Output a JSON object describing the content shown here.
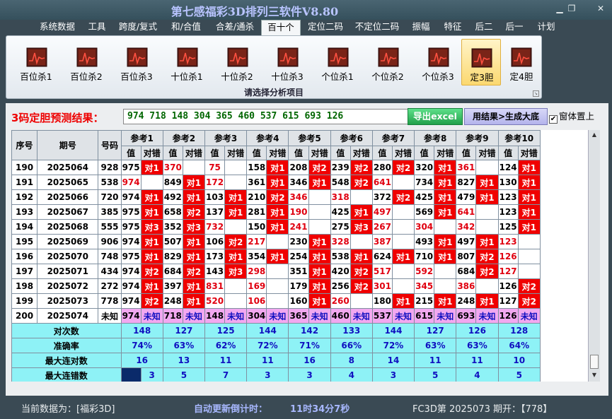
{
  "window": {
    "title": "第七感福彩3D排列三软件V8.80"
  },
  "menu": [
    "系统数据",
    "工具",
    "跨度/复式",
    "和/合值",
    "合差/通杀",
    "百十个",
    "定位二码",
    "不定位二码",
    "振幅",
    "特征",
    "后二",
    "后一",
    "计划"
  ],
  "menu_active": 5,
  "ribbon": {
    "items": [
      "百位杀1",
      "百位杀2",
      "百位杀3",
      "十位杀1",
      "十位杀2",
      "十位杀3",
      "个位杀1",
      "个位杀2",
      "个位杀3",
      "定3胆",
      "定4胆"
    ],
    "selected": 9,
    "caption": "请选择分析项目"
  },
  "result": {
    "label": "3码定胆预测结果：",
    "value": "974 718 148 304 365 460 537 615 693 126",
    "export_label": "导出excel",
    "gen_label": "用结果>生成大底",
    "top_label": "窗体置上",
    "top_checked": true
  },
  "table": {
    "h_seq": "序号",
    "h_period": "期号",
    "h_num": "号码",
    "ref_labels": [
      "参考1",
      "参考2",
      "参考3",
      "参考4",
      "参考5",
      "参考6",
      "参考7",
      "参考8",
      "参考9",
      "参考10"
    ],
    "sub_val": "值",
    "sub_res": "对错",
    "rows": [
      {
        "seq": "190",
        "period": "2025064",
        "num": "928",
        "v": [
          "975",
          "370",
          "75",
          "158",
          "208",
          "239",
          "280",
          "320",
          "361",
          "124"
        ],
        "r": [
          "对1",
          "",
          "",
          "对1",
          "对2",
          "对2",
          "对2",
          "对1",
          "",
          "对1"
        ]
      },
      {
        "seq": "191",
        "period": "2025065",
        "num": "538",
        "v": [
          "974",
          "849",
          "172",
          "361",
          "346",
          "548",
          "641",
          "734",
          "827",
          "130"
        ],
        "r": [
          "",
          "对1",
          "",
          "对1",
          "对1",
          "对2",
          "",
          "对1",
          "对1",
          "对1"
        ]
      },
      {
        "seq": "192",
        "period": "2025066",
        "num": "720",
        "v": [
          "974",
          "492",
          "103",
          "210",
          "346",
          "318",
          "372",
          "425",
          "479",
          "123"
        ],
        "r": [
          "对1",
          "对1",
          "对1",
          "对2",
          "",
          "",
          "对2",
          "对1",
          "对1",
          "对1"
        ]
      },
      {
        "seq": "193",
        "period": "2025067",
        "num": "385",
        "v": [
          "975",
          "658",
          "137",
          "281",
          "190",
          "425",
          "497",
          "569",
          "641",
          "123"
        ],
        "r": [
          "对1",
          "对2",
          "对1",
          "对1",
          "",
          "对1",
          "",
          "对1",
          "",
          "对1"
        ]
      },
      {
        "seq": "194",
        "period": "2025068",
        "num": "555",
        "v": [
          "975",
          "352",
          "732",
          "150",
          "241",
          "275",
          "267",
          "304",
          "342",
          "125"
        ],
        "r": [
          "对3",
          "对3",
          "",
          "对1",
          "",
          "对3",
          "",
          "",
          "",
          "对1"
        ]
      },
      {
        "seq": "195",
        "period": "2025069",
        "num": "906",
        "v": [
          "974",
          "507",
          "106",
          "217",
          "230",
          "328",
          "387",
          "493",
          "497",
          "123"
        ],
        "r": [
          "对1",
          "对1",
          "对2",
          "",
          "对1",
          "",
          "",
          "对1",
          "对1",
          ""
        ]
      },
      {
        "seq": "196",
        "period": "2025070",
        "num": "748",
        "v": [
          "975",
          "829",
          "173",
          "354",
          "254",
          "538",
          "624",
          "710",
          "807",
          "126"
        ],
        "r": [
          "对1",
          "对1",
          "对1",
          "对1",
          "对1",
          "对1",
          "对1",
          "对1",
          "对2",
          ""
        ]
      },
      {
        "seq": "197",
        "period": "2025071",
        "num": "434",
        "v": [
          "974",
          "684",
          "143",
          "298",
          "351",
          "420",
          "517",
          "592",
          "684",
          "127"
        ],
        "r": [
          "对2",
          "对2",
          "对3",
          "",
          "对1",
          "对2",
          "",
          "",
          "对2",
          ""
        ]
      },
      {
        "seq": "198",
        "period": "2025072",
        "num": "272",
        "v": [
          "974",
          "397",
          "831",
          "169",
          "179",
          "256",
          "301",
          "345",
          "386",
          "126"
        ],
        "r": [
          "对1",
          "对1",
          "",
          "",
          "对1",
          "对2",
          "",
          "",
          "",
          "对2"
        ]
      },
      {
        "seq": "199",
        "period": "2025073",
        "num": "778",
        "v": [
          "974",
          "248",
          "520",
          "106",
          "160",
          "260",
          "180",
          "215",
          "248",
          "127"
        ],
        "r": [
          "对2",
          "对1",
          "",
          "",
          "对1",
          "",
          "对1",
          "对1",
          "对1",
          "对2"
        ]
      },
      {
        "seq": "200",
        "period": "2025074",
        "num": "未知",
        "v": [
          "974",
          "718",
          "148",
          "304",
          "365",
          "460",
          "537",
          "615",
          "693",
          "126"
        ],
        "r": [
          "未知",
          "未知",
          "未知",
          "未知",
          "未知",
          "未知",
          "未知",
          "未知",
          "未知",
          "未知"
        ]
      }
    ],
    "summary": [
      {
        "label": "对次数",
        "vals": [
          "148",
          "127",
          "125",
          "144",
          "142",
          "133",
          "144",
          "127",
          "126",
          "128"
        ]
      },
      {
        "label": "准确率",
        "vals": [
          "74%",
          "63%",
          "62%",
          "72%",
          "71%",
          "66%",
          "72%",
          "63%",
          "63%",
          "64%"
        ]
      },
      {
        "label": "最大连对数",
        "vals": [
          "16",
          "13",
          "11",
          "11",
          "16",
          "8",
          "14",
          "11",
          "11",
          "10"
        ]
      },
      {
        "label": "最大连错数",
        "vals": [
          "3",
          "5",
          "7",
          "3",
          "3",
          "4",
          "3",
          "5",
          "4",
          "5"
        ]
      }
    ]
  },
  "status": {
    "current_label": "当前数据为：[福彩3D]",
    "countdown_label": "自动更新倒计时：",
    "countdown_value": "11时34分7秒",
    "fc3d": "FC3D第 2025073 期开：【778】"
  },
  "colors": {
    "hit": "#f00000",
    "miss_text": "#e00010",
    "unknown": "#f2a8f0",
    "summary": "#8ef2f6",
    "summary_text": "#1010c0"
  }
}
